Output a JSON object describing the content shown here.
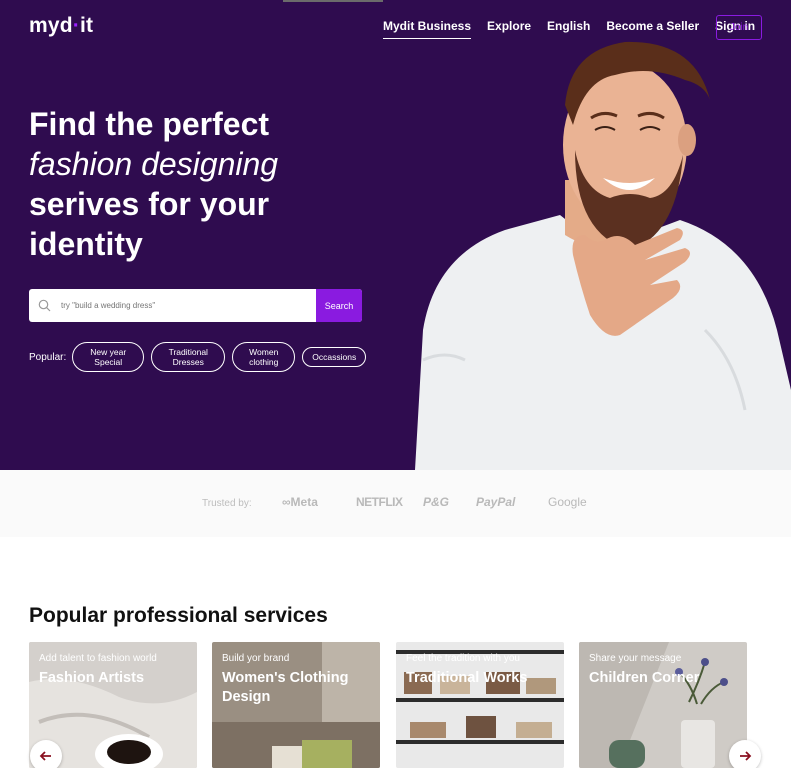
{
  "brand": {
    "logo_left": "myd",
    "logo_dot": "·",
    "logo_right": "it"
  },
  "nav": {
    "items": [
      "Mydit Business",
      "Explore",
      "English",
      "Become a Seller",
      "Sign in"
    ],
    "join_label": "Join"
  },
  "hero": {
    "line1": "Find the perfect",
    "line2": "fashion designing",
    "line3": "serives for your",
    "line4": "identity"
  },
  "search": {
    "placeholder": "try \"build a wedding dress\"",
    "button_label": "Search"
  },
  "popular": {
    "label": "Popular:",
    "tags": [
      {
        "line1": "New year",
        "line2": "Special"
      },
      {
        "line1": "Traditional",
        "line2": "Dresses"
      },
      {
        "line1": "Women",
        "line2": "clothing"
      },
      {
        "line1": "Occassions",
        "line2": ""
      }
    ]
  },
  "trusted": {
    "label": "Trusted by:",
    "brands": [
      "∞Meta",
      "NETFLIX",
      "P&G",
      "PayPal",
      "Google"
    ]
  },
  "services": {
    "title": "Popular professional services",
    "cards": [
      {
        "tag": "Add talent to fashion world",
        "title": "Fashion Artists"
      },
      {
        "tag": "Build yor brand",
        "title": "Women's Clothing Design"
      },
      {
        "tag": "Feel the tradition with you",
        "title": "Traditional Works"
      },
      {
        "tag": "Share your message",
        "title": "Children Corner"
      }
    ]
  },
  "colors": {
    "hero_bg": "#2f0c4f",
    "accent": "#8a1be0",
    "arrow": "#8a1020"
  },
  "icons": [
    "search-icon",
    "arrow-left-icon",
    "arrow-right-icon"
  ]
}
